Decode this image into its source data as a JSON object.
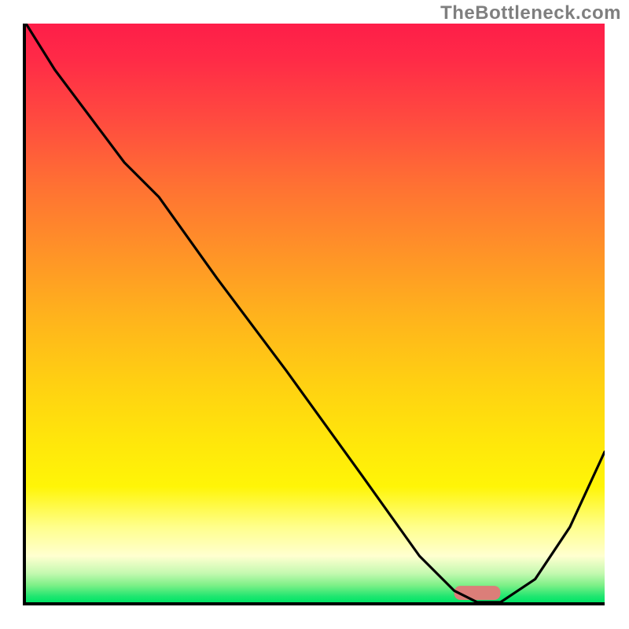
{
  "attribution": "TheBottleneck.com",
  "chart_data": {
    "type": "line",
    "title": "",
    "xlabel": "",
    "ylabel": "",
    "xlim": [
      0,
      100
    ],
    "ylim": [
      0,
      100
    ],
    "grid": false,
    "legend": false,
    "series": [
      {
        "name": "bottleneck-curve",
        "x": [
          0,
          5,
          11,
          17,
          23,
          33,
          45,
          58,
          68,
          74,
          78,
          82,
          88,
          94,
          100
        ],
        "y": [
          100,
          92,
          84,
          76,
          70,
          56,
          40,
          22,
          8,
          2,
          0,
          0,
          4,
          13,
          26
        ]
      }
    ],
    "optimal_range_x": [
      74,
      82
    ],
    "gradient_note": "background gradient encodes bottleneck severity: red (top) = high bottleneck, green (bottom) = no bottleneck"
  }
}
